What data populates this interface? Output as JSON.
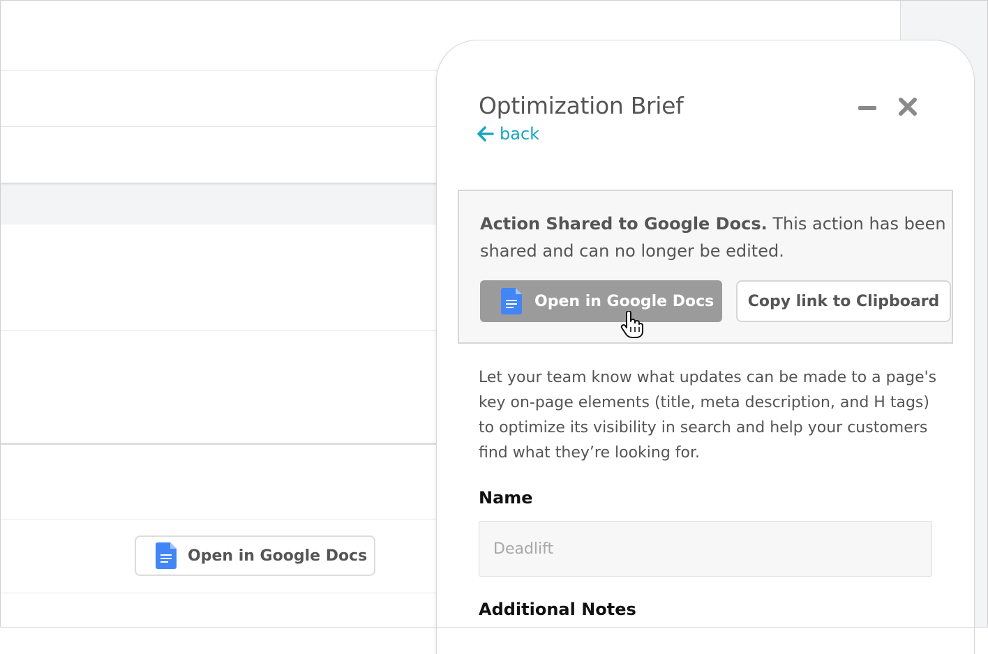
{
  "background": {
    "open_gdocs_label": "Open in Google Docs"
  },
  "modal": {
    "title": "Optimization Brief",
    "back_label": "back",
    "shared": {
      "heading": "Action Shared to Google Docs.",
      "message": " This action has been shared and can no longer be edited.",
      "open_gdocs_label": "Open in Google Docs",
      "copy_link_label": "Copy link to Clipboard"
    },
    "description": "Let your team know what updates can be made to a page's key on-page elements (title, meta description, and H tags) to optimize its visibility in search and help your customers find what they’re looking for.",
    "name_label": "Name",
    "name_placeholder": "Deadlift",
    "notes_label": "Additional Notes"
  },
  "colors": {
    "accent": "#17a5c4",
    "gdocs_blue": "#4285f4",
    "button_gray": "#9b9b9b"
  },
  "icons": [
    "google-docs-icon",
    "arrow-left-icon",
    "minimize-icon",
    "close-icon",
    "hand-cursor-icon"
  ]
}
